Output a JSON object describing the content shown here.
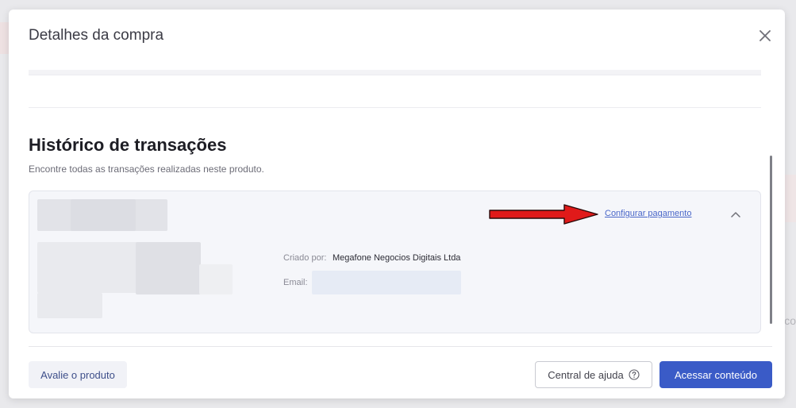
{
  "modal": {
    "title": "Detalhes da compra",
    "close_icon": "close-icon"
  },
  "history": {
    "title": "Histórico de transações",
    "subtitle": "Encontre todas as transações realizadas neste produto."
  },
  "transaction": {
    "configure_link": "Configurar pagamento",
    "created_by_label": "Criado por:",
    "created_by_value": "Megafone Negocios Digitais Ltda",
    "email_label": "Email:",
    "chevron_icon": "chevron-up-icon",
    "annotation_icon": "red-arrow-icon"
  },
  "footer": {
    "rate_label": "Avalie o produto",
    "help_label": "Central de ajuda",
    "help_icon": "help-circle-icon",
    "access_label": "Acessar conteúdo"
  },
  "colors": {
    "primary": "#3a5bc7",
    "link": "#4a67c9",
    "annotation": "#e01a1a"
  }
}
